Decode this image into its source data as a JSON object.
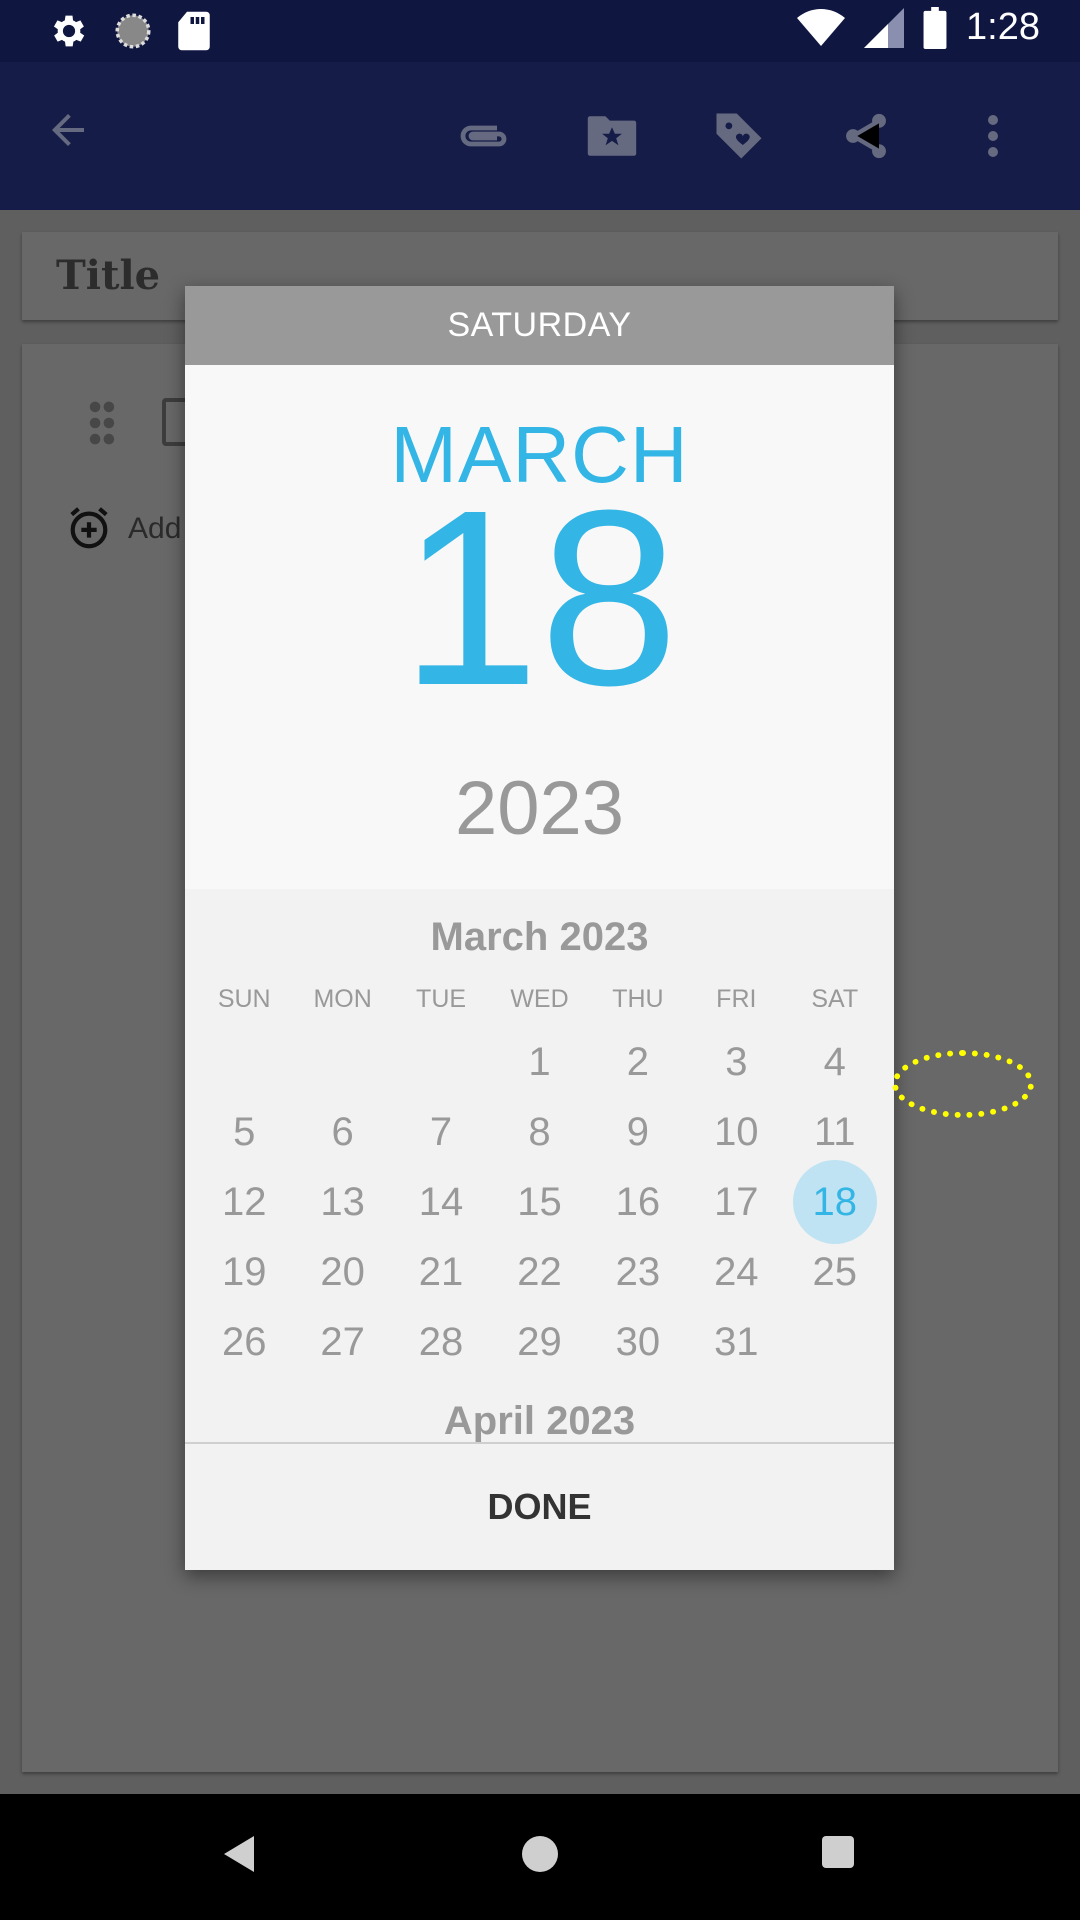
{
  "status_bar": {
    "time": "1:28",
    "left_icons": [
      "gear-icon",
      "circle-progress-icon",
      "sd-card-icon"
    ],
    "right_icons": [
      "wifi-icon",
      "signal-icon",
      "battery-icon"
    ]
  },
  "app_bar": {
    "back_icon": "arrow-back-icon",
    "actions": [
      "paperclip-icon",
      "folder-star-icon",
      "tag-heart-icon",
      "share-icon",
      "more-vert-icon"
    ]
  },
  "background": {
    "title_placeholder": "Title",
    "add_reminder": "Add"
  },
  "dialog": {
    "weekday": "SATURDAY",
    "month": "MARCH",
    "day": "18",
    "year": "2023",
    "calendar_title": "March 2023",
    "next_calendar_title": "April 2023",
    "weekdays": [
      "SUN",
      "MON",
      "TUE",
      "WED",
      "THU",
      "FRI",
      "SAT"
    ],
    "weeks": [
      [
        "",
        "",
        "",
        "1",
        "2",
        "3",
        "4"
      ],
      [
        "5",
        "6",
        "7",
        "8",
        "9",
        "10",
        "11"
      ],
      [
        "12",
        "13",
        "14",
        "15",
        "16",
        "17",
        "18"
      ],
      [
        "19",
        "20",
        "21",
        "22",
        "23",
        "24",
        "25"
      ],
      [
        "26",
        "27",
        "28",
        "29",
        "30",
        "31",
        ""
      ]
    ],
    "selected_day": "18",
    "done_label": "DONE"
  },
  "colors": {
    "accent": "#33b5e5",
    "header_gray": "#999999",
    "selected_bg": "#bfe3f2"
  }
}
